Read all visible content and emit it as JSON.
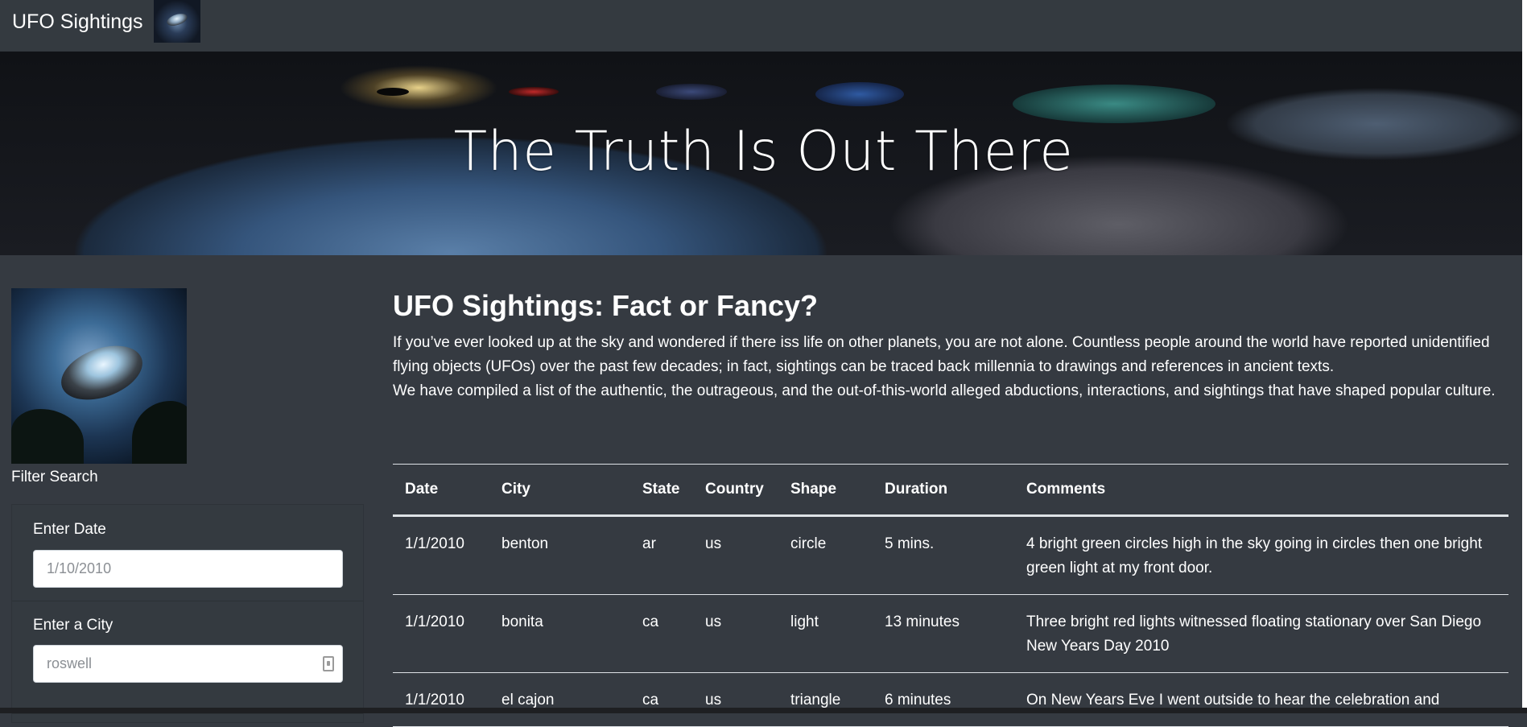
{
  "navbar": {
    "brand": "UFO Sightings",
    "logo_icon": "ufo-logo-icon"
  },
  "hero": {
    "title": "The Truth Is Out There"
  },
  "sidebar": {
    "filter_label": "Filter Search",
    "filters": [
      {
        "label": "Enter Date",
        "value": "1/10/2010"
      },
      {
        "label": "Enter a City",
        "value": "roswell"
      }
    ]
  },
  "main": {
    "title": "UFO Sightings: Fact or Fancy?",
    "paragraph1": "If you’ve ever looked up at the sky and wondered if there iss life on other planets, you are not alone. Countless people around the world have reported unidentified flying objects (UFOs) over the past few decades; in fact, sightings can be traced back millennia to drawings and references in ancient texts.",
    "paragraph2": "We have compiled a list of the authentic, the outrageous, and the out-of-this-world alleged abductions, interactions, and sightings that have shaped popular culture."
  },
  "table": {
    "headers": [
      "Date",
      "City",
      "State",
      "Country",
      "Shape",
      "Duration",
      "Comments"
    ],
    "rows": [
      [
        "1/1/2010",
        "benton",
        "ar",
        "us",
        "circle",
        "5 mins.",
        "4 bright green circles high in the sky going in circles then one bright green light at my front door."
      ],
      [
        "1/1/2010",
        "bonita",
        "ca",
        "us",
        "light",
        "13 minutes",
        "Three bright red lights witnessed floating stationary over San Diego New Years Day 2010"
      ],
      [
        "1/1/2010",
        "el cajon",
        "ca",
        "us",
        "triangle",
        "6 minutes",
        "On New Years Eve I went outside to hear the celebration and"
      ]
    ]
  }
}
